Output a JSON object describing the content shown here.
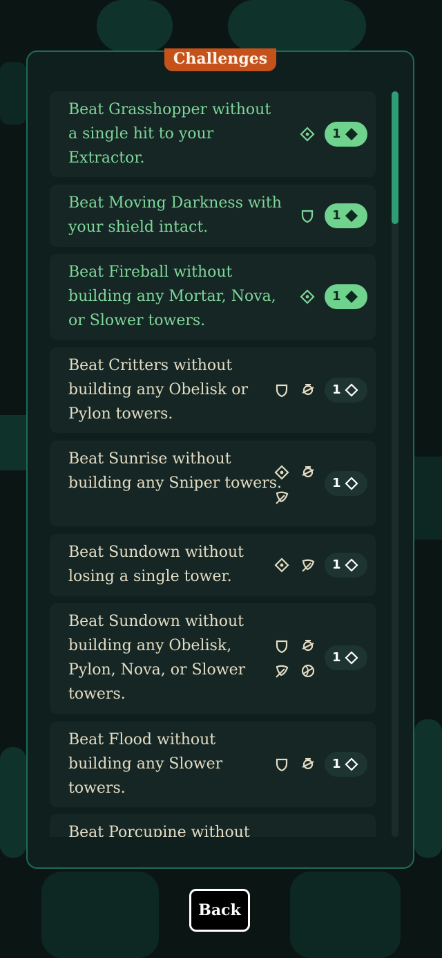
{
  "title": "Challenges",
  "back_label": "Back",
  "colors": {
    "accent_title": "#c5521b",
    "completed_text": "#7fd69a",
    "completed_badge": "#6fd38e",
    "pending_text": "#e4dcc4",
    "panel_border": "#1f6b58"
  },
  "challenges": [
    {
      "text": "Beat Grasshopper without a single hit to your Extractor.",
      "reward": "1",
      "completed": true,
      "icons": [
        "target-diamond-icon"
      ]
    },
    {
      "text": "Beat Moving Darkness with your shield intact.",
      "reward": "1",
      "completed": true,
      "icons": [
        "shield-icon"
      ]
    },
    {
      "text": "Beat Fireball without building any Mortar, Nova, or Slower towers.",
      "reward": "1",
      "completed": true,
      "icons": [
        "target-diamond-icon"
      ]
    },
    {
      "text": "Beat Critters without building any Obelisk or Pylon towers.",
      "reward": "1",
      "completed": false,
      "icons": [
        "shield-icon",
        "orbit-icon"
      ]
    },
    {
      "text": "Beat Sunrise without building any Sniper towers.",
      "reward": "1",
      "completed": false,
      "icons": [
        "target-diamond-icon",
        "orbit-icon",
        "leaf-icon"
      ]
    },
    {
      "text": "Beat Sundown without losing a single tower.",
      "reward": "1",
      "completed": false,
      "icons": [
        "target-diamond-icon",
        "leaf-icon"
      ]
    },
    {
      "text": "Beat Sundown without building any Obelisk, Pylon, Nova, or Slower towers.",
      "reward": "1",
      "completed": false,
      "icons": [
        "shield-icon",
        "orbit-icon",
        "leaf-icon",
        "globe-icon"
      ]
    },
    {
      "text": "Beat Flood without building any Slower towers.",
      "reward": "1",
      "completed": false,
      "icons": [
        "shield-icon",
        "orbit-icon"
      ]
    },
    {
      "text": "Beat Porcupine without",
      "reward": "",
      "completed": false,
      "icons": []
    }
  ]
}
